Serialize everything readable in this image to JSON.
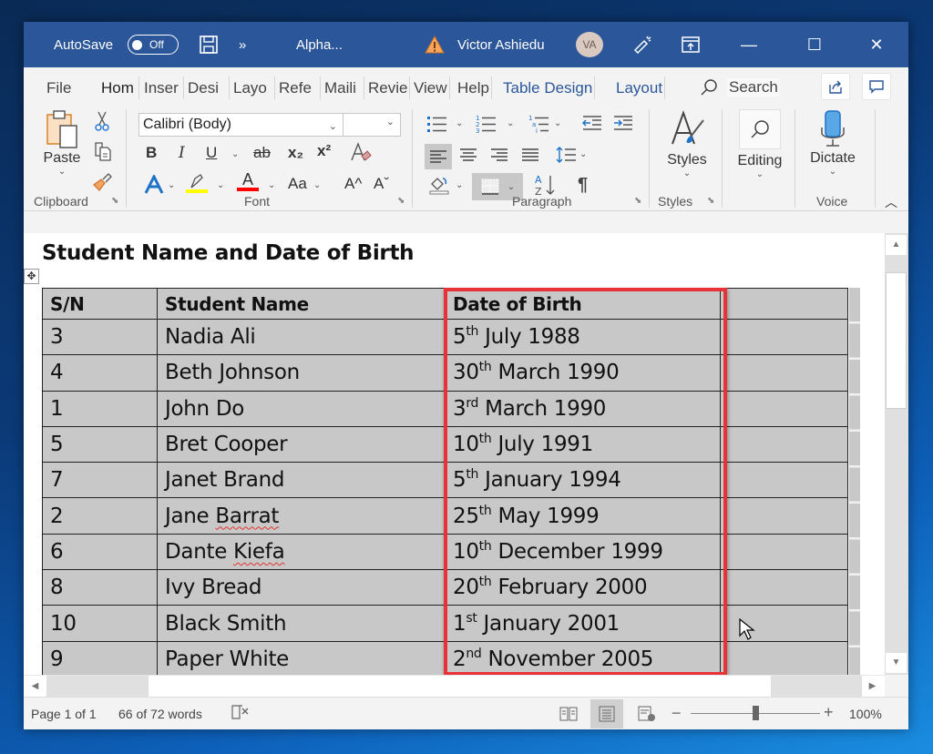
{
  "titlebar": {
    "autosave_label": "AutoSave",
    "autosave_state": "Off",
    "more_glyph": "»",
    "doc_title": "Alpha...",
    "user_name": "Victor Ashiedu",
    "avatar_initials": "VA",
    "min_glyph": "—",
    "max_glyph": "☐",
    "close_glyph": "✕"
  },
  "tabs": [
    {
      "label": "File"
    },
    {
      "label": "Hom"
    },
    {
      "label": "Inser"
    },
    {
      "label": "Desi"
    },
    {
      "label": "Layo"
    },
    {
      "label": "Refe"
    },
    {
      "label": "Maili"
    },
    {
      "label": "Revie"
    },
    {
      "label": "View"
    },
    {
      "label": "Help"
    },
    {
      "label": "Table Design"
    },
    {
      "label": "Layout"
    }
  ],
  "search": {
    "label": "Search"
  },
  "ribbon": {
    "clipboard": {
      "paste_label": "Paste",
      "group_label": "Clipboard"
    },
    "font": {
      "font_name": "Calibri (Body)",
      "font_size": "",
      "group_label": "Font",
      "bold": "B",
      "italic": "I",
      "underline": "U",
      "strike": "ab",
      "subscript": "x₂",
      "superscript": "x²",
      "change_case": "Aa",
      "grow": "A^",
      "shrink": "Aˇ"
    },
    "paragraph": {
      "group_label": "Paragraph",
      "pilcrow": "¶"
    },
    "styles": {
      "button_label": "Styles",
      "group_label": "Styles"
    },
    "editing": {
      "button_label": "Editing"
    },
    "voice": {
      "button_label": "Dictate",
      "group_label": "Voice"
    },
    "colors": {
      "highlight": "#ffff00",
      "font_color": "#ff0000",
      "accent": "#2b579a"
    }
  },
  "document": {
    "heading": "Student Name and Date of Birth",
    "table": {
      "columns": [
        "S/N",
        "Student Name",
        "Date of Birth",
        ""
      ],
      "rows": [
        {
          "sn": "3",
          "name": "Nadia Ali",
          "day": "5",
          "suffix": "th",
          "rest": " July 1988"
        },
        {
          "sn": "4",
          "name": "Beth Johnson",
          "day": "30",
          "suffix": "th",
          "rest": " March 1990"
        },
        {
          "sn": "1",
          "name": "John Do",
          "day": "3",
          "suffix": "rd",
          "rest": " March 1990"
        },
        {
          "sn": "5",
          "name": "Bret Cooper",
          "day": "10",
          "suffix": "th",
          "rest": " July 1991"
        },
        {
          "sn": "7",
          "name": "Janet Brand",
          "day": "5",
          "suffix": "th",
          "rest": " January 1994"
        },
        {
          "sn": "2",
          "name_first": "Jane ",
          "name_spell": "Barrat",
          "day": "25",
          "suffix": "th",
          "rest": " May 1999"
        },
        {
          "sn": "6",
          "name_first": "Dante ",
          "name_spell": "Kiefa",
          "day": "10",
          "suffix": "th",
          "rest": " December 1999"
        },
        {
          "sn": "8",
          "name": "Ivy Bread",
          "day": "20",
          "suffix": "th",
          "rest": " February 2000"
        },
        {
          "sn": "10",
          "name": "Black Smith",
          "day": "1",
          "suffix": "st",
          "rest": " January 2001"
        },
        {
          "sn": "9",
          "name": "Paper White",
          "day": "2",
          "suffix": "nd",
          "rest": " November 2005"
        }
      ]
    },
    "highlight_color": "#e8323a"
  },
  "statusbar": {
    "page": "Page 1 of 1",
    "words": "66 of 72 words",
    "zoom_level": "100%",
    "zoom_minus": "−",
    "zoom_plus": "+"
  }
}
